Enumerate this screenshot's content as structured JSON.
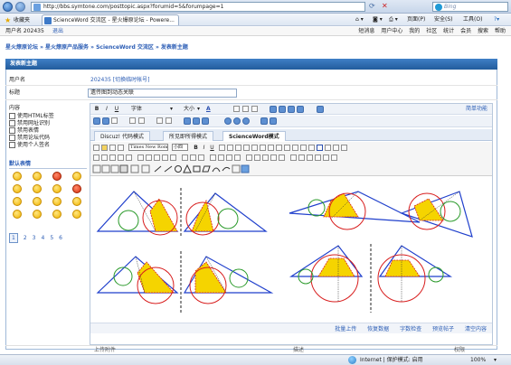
{
  "browser": {
    "url": "http://bbs.symtone.com/posttopic.aspx?forumid=5&forumpage=1",
    "search_placeholder": "Bing",
    "tabs": [
      {
        "label": "收藏夹"
      },
      {
        "label": "ScienceWord 交流区 - 星火爆原论坛 - Powere..."
      }
    ],
    "commands": [
      "页面(P)",
      "安全(S)",
      "工具(O)"
    ],
    "status_internet": "Internet | 保护模式: 启用",
    "zoom": "100%"
  },
  "userbar": {
    "user": "用户名 202435",
    "logout": "退出",
    "links": [
      "短消息",
      "用户中心",
      "我的",
      "社区",
      "统计",
      "会员",
      "搜索",
      "帮助"
    ]
  },
  "breadcrumb": "星火燎原论坛 » 星火燎原产品服务 » ScienceWord 交流区 » 发表新主题",
  "form": {
    "panel_title": "发表新主题",
    "username_label": "用户名",
    "username_value": "202435 [切换临时帐号]",
    "subject_label": "标题",
    "subject_value": "遗传图到动态关联",
    "content_label": "内容",
    "options": [
      "使用HTML标签",
      "禁用网址识别",
      "禁用表情",
      "禁用论坛代码",
      "使用个人签名"
    ],
    "emote_title": "默认表情",
    "emote_pages": [
      "1",
      "2",
      "3",
      "4",
      "5",
      "6"
    ],
    "simple_mode": "简单功能",
    "font_label": "字体",
    "size_label": "大小",
    "tabs": [
      "Discuz! 代码模式",
      "所见即所得模式",
      "ScienceWord模式"
    ],
    "font_name": "Times New Roman",
    "font_size": "小四",
    "bottom_links": [
      "批量上传",
      "恢复数据",
      "字数检查",
      "预览帖子",
      "清空内容"
    ],
    "attach_label": "上传附件",
    "attach_desc": "描述",
    "attach_perm": "权限"
  },
  "figure": {
    "triangle_color": "#1f3fcc",
    "fill_color": "#f5d400",
    "red_circle": "#d81e1e",
    "green_circle": "#2a9a2a"
  }
}
